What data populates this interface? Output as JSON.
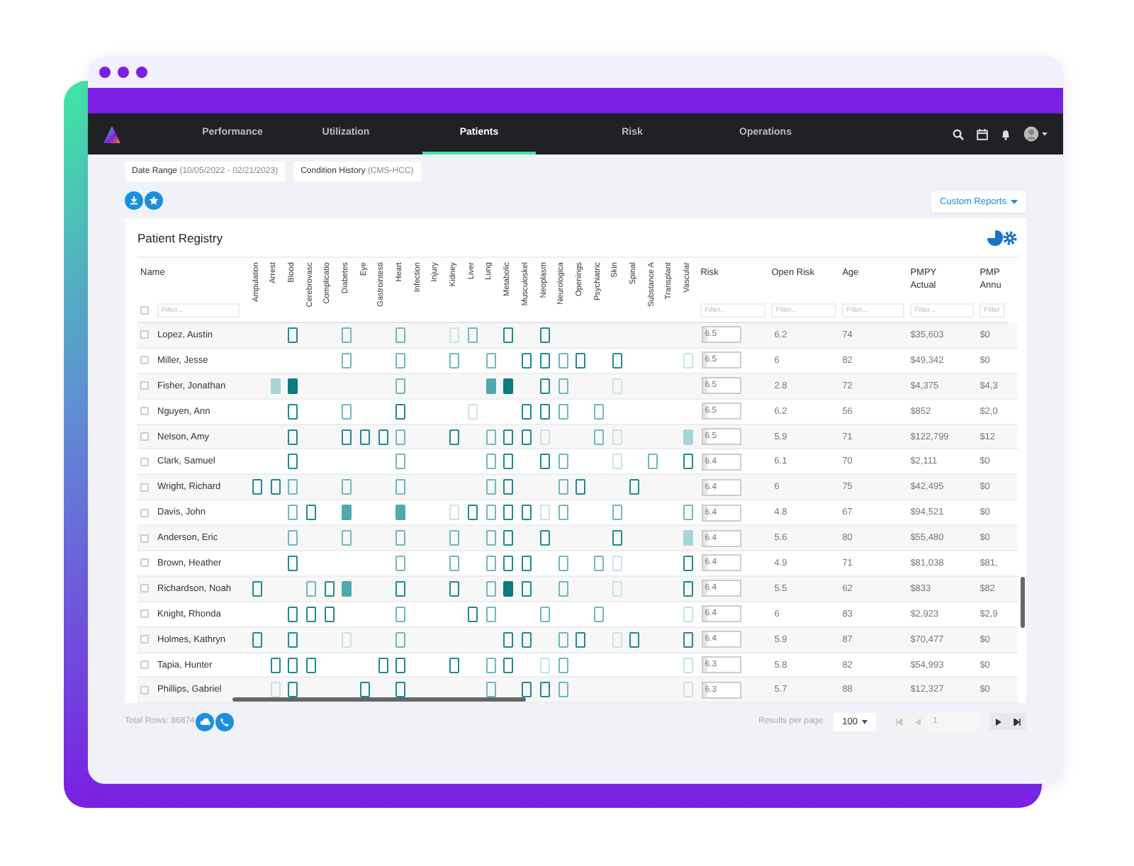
{
  "nav": {
    "tabs": [
      {
        "label": "Performance",
        "selected": false
      },
      {
        "label": "Utilization",
        "selected": false
      },
      {
        "label": "Patients",
        "selected": true
      },
      {
        "label": "Risk",
        "selected": false
      },
      {
        "label": "Operations",
        "selected": false
      }
    ]
  },
  "filters": [
    {
      "label": "Date Range",
      "value": "(10/05/2022 - 02/21/2023)"
    },
    {
      "label": "Condition History",
      "value": "(CMS-HCC)"
    }
  ],
  "custom_reports": {
    "label": "Custom Reports"
  },
  "registry": {
    "title": "Patient Registry",
    "name_column": {
      "label": "Name",
      "placeholder": "Filter...",
      "checked": false
    },
    "condition_columns": [
      "Ampulation",
      "Arrest",
      "Blood",
      "Cerebrovasc",
      "Complicatio",
      "Diabetes",
      "Eye",
      "Gastrointesti",
      "Heart",
      "Infection",
      "Injury",
      "Kidney",
      "Liver",
      "Lung",
      "Metabolic",
      "Musculoskel",
      "Neoplasm",
      "Neurologica",
      "Openings",
      "Psychiatric",
      "Skin",
      "Spinal",
      "Substance A",
      "Transplant",
      "Vascular"
    ],
    "value_columns": [
      {
        "label": "Risk",
        "placeholder": "Filter..."
      },
      {
        "label": "Open Risk",
        "placeholder": "Filter..."
      },
      {
        "label": "Age",
        "placeholder": "Filter..."
      },
      {
        "label": "PMPY",
        "sublabel": "Actual",
        "placeholder": "Filter..."
      },
      {
        "label": "PMP",
        "sublabel": "Annu",
        "placeholder": "Filter"
      }
    ],
    "rows": [
      {
        "name": "Lopez, Austin",
        "checked": false,
        "risk": "6.5",
        "open_risk": "6.2",
        "age": "74",
        "pmpy_actual": "$35,603",
        "column_5": "$0",
        "conditions": [
          {
            "kind": "none"
          },
          {
            "kind": "none"
          },
          {
            "kind": "outline",
            "color": "#1e8a8f"
          },
          {
            "kind": "none"
          },
          {
            "kind": "none"
          },
          {
            "kind": "outline",
            "color": "#6fb8bb"
          },
          {
            "kind": "none"
          },
          {
            "kind": "none"
          },
          {
            "kind": "outline",
            "color": "#6fb8bb"
          },
          {
            "kind": "none"
          },
          {
            "kind": "none"
          },
          {
            "kind": "outline",
            "color": "#c9e3e4"
          },
          {
            "kind": "outline",
            "color": "#6fb8bb"
          },
          {
            "kind": "none"
          },
          {
            "kind": "outline",
            "color": "#1e8a8f"
          },
          {
            "kind": "none"
          },
          {
            "kind": "outline",
            "color": "#1e8a8f"
          },
          {
            "kind": "none"
          },
          {
            "kind": "none"
          },
          {
            "kind": "none"
          },
          {
            "kind": "none"
          },
          {
            "kind": "none"
          },
          {
            "kind": "none"
          },
          {
            "kind": "none"
          },
          {
            "kind": "none"
          }
        ]
      },
      {
        "name": "Miller, Jesse",
        "checked": false,
        "risk": "6.5",
        "open_risk": "6",
        "age": "82",
        "pmpy_actual": "$49,342",
        "column_5": "$0",
        "conditions": [
          {
            "kind": "none"
          },
          {
            "kind": "none"
          },
          {
            "kind": "none"
          },
          {
            "kind": "none"
          },
          {
            "kind": "none"
          },
          {
            "kind": "outline",
            "color": "#6fb8bb"
          },
          {
            "kind": "none"
          },
          {
            "kind": "none"
          },
          {
            "kind": "outline",
            "color": "#6fb8bb"
          },
          {
            "kind": "none"
          },
          {
            "kind": "none"
          },
          {
            "kind": "outline",
            "color": "#6fb8bb"
          },
          {
            "kind": "none"
          },
          {
            "kind": "outline",
            "color": "#6fb8bb"
          },
          {
            "kind": "none"
          },
          {
            "kind": "outline",
            "color": "#1e8a8f"
          },
          {
            "kind": "outline",
            "color": "#1e8a8f"
          },
          {
            "kind": "outline",
            "color": "#6fb8bb"
          },
          {
            "kind": "outline",
            "color": "#1e8a8f"
          },
          {
            "kind": "none"
          },
          {
            "kind": "outline",
            "color": "#1e8a8f"
          },
          {
            "kind": "none"
          },
          {
            "kind": "none"
          },
          {
            "kind": "none"
          },
          {
            "kind": "outline",
            "color": "#c9e3e4"
          }
        ]
      },
      {
        "name": "Fisher, Jonathan",
        "checked": false,
        "risk": "6.5",
        "open_risk": "2.8",
        "age": "72",
        "pmpy_actual": "$4,375",
        "column_5": "$4,3",
        "conditions": [
          {
            "kind": "none"
          },
          {
            "kind": "filled",
            "color": "#a8d5d7"
          },
          {
            "kind": "filled",
            "color": "#0d7a80"
          },
          {
            "kind": "none"
          },
          {
            "kind": "none"
          },
          {
            "kind": "none"
          },
          {
            "kind": "none"
          },
          {
            "kind": "none"
          },
          {
            "kind": "outline",
            "color": "#6fb8bb"
          },
          {
            "kind": "none"
          },
          {
            "kind": "none"
          },
          {
            "kind": "none"
          },
          {
            "kind": "none"
          },
          {
            "kind": "filled",
            "color": "#4fa9ad"
          },
          {
            "kind": "filled",
            "color": "#0d7a80"
          },
          {
            "kind": "none"
          },
          {
            "kind": "outline",
            "color": "#1e8a8f"
          },
          {
            "kind": "outline",
            "color": "#6fb8bb"
          },
          {
            "kind": "none"
          },
          {
            "kind": "none"
          },
          {
            "kind": "outline",
            "color": "#c9e3e4"
          },
          {
            "kind": "none"
          },
          {
            "kind": "none"
          },
          {
            "kind": "none"
          },
          {
            "kind": "none"
          }
        ]
      },
      {
        "name": "Nguyen, Ann",
        "checked": false,
        "risk": "6.5",
        "open_risk": "6.2",
        "age": "56",
        "pmpy_actual": "$852",
        "column_5": "$2,0",
        "conditions": [
          {
            "kind": "none"
          },
          {
            "kind": "none"
          },
          {
            "kind": "outline",
            "color": "#1e8a8f"
          },
          {
            "kind": "none"
          },
          {
            "kind": "none"
          },
          {
            "kind": "outline",
            "color": "#6fb8bb"
          },
          {
            "kind": "none"
          },
          {
            "kind": "none"
          },
          {
            "kind": "outline",
            "color": "#1e8a8f"
          },
          {
            "kind": "none"
          },
          {
            "kind": "none"
          },
          {
            "kind": "none"
          },
          {
            "kind": "outline",
            "color": "#c9e3e4"
          },
          {
            "kind": "none"
          },
          {
            "kind": "none"
          },
          {
            "kind": "outline",
            "color": "#1e8a8f"
          },
          {
            "kind": "outline",
            "color": "#1e8a8f"
          },
          {
            "kind": "outline",
            "color": "#6fb8bb"
          },
          {
            "kind": "none"
          },
          {
            "kind": "outline",
            "color": "#6fb8bb"
          },
          {
            "kind": "none"
          },
          {
            "kind": "none"
          },
          {
            "kind": "none"
          },
          {
            "kind": "none"
          },
          {
            "kind": "none"
          }
        ]
      },
      {
        "name": "Nelson, Amy",
        "checked": false,
        "risk": "6.5",
        "open_risk": "5.9",
        "age": "71",
        "pmpy_actual": "$122,799",
        "column_5": "$12",
        "conditions": [
          {
            "kind": "none"
          },
          {
            "kind": "none"
          },
          {
            "kind": "outline",
            "color": "#1e8a8f"
          },
          {
            "kind": "none"
          },
          {
            "kind": "none"
          },
          {
            "kind": "outline",
            "color": "#1e8a8f"
          },
          {
            "kind": "outline",
            "color": "#1e8a8f"
          },
          {
            "kind": "outline",
            "color": "#1e8a8f"
          },
          {
            "kind": "outline",
            "color": "#6fb8bb"
          },
          {
            "kind": "none"
          },
          {
            "kind": "none"
          },
          {
            "kind": "outline",
            "color": "#1e8a8f"
          },
          {
            "kind": "none"
          },
          {
            "kind": "outline",
            "color": "#6fb8bb"
          },
          {
            "kind": "outline",
            "color": "#1e8a8f"
          },
          {
            "kind": "outline",
            "color": "#1e8a8f"
          },
          {
            "kind": "outline",
            "color": "#c9e3e4"
          },
          {
            "kind": "none"
          },
          {
            "kind": "none"
          },
          {
            "kind": "outline",
            "color": "#6fb8bb"
          },
          {
            "kind": "outline",
            "color": "#c9e3e4"
          },
          {
            "kind": "none"
          },
          {
            "kind": "none"
          },
          {
            "kind": "none"
          },
          {
            "kind": "filled",
            "color": "#a8d5d7"
          }
        ]
      },
      {
        "name": "Clark, Samuel",
        "checked": false,
        "risk": "6.4",
        "open_risk": "6.1",
        "age": "70",
        "pmpy_actual": "$2,111",
        "column_5": "$0",
        "conditions": [
          {
            "kind": "none"
          },
          {
            "kind": "none"
          },
          {
            "kind": "outline",
            "color": "#1e8a8f"
          },
          {
            "kind": "none"
          },
          {
            "kind": "none"
          },
          {
            "kind": "none"
          },
          {
            "kind": "none"
          },
          {
            "kind": "none"
          },
          {
            "kind": "outline",
            "color": "#6fb8bb"
          },
          {
            "kind": "none"
          },
          {
            "kind": "none"
          },
          {
            "kind": "none"
          },
          {
            "kind": "none"
          },
          {
            "kind": "outline",
            "color": "#6fb8bb"
          },
          {
            "kind": "outline",
            "color": "#1e8a8f"
          },
          {
            "kind": "none"
          },
          {
            "kind": "outline",
            "color": "#1e8a8f"
          },
          {
            "kind": "outline",
            "color": "#6fb8bb"
          },
          {
            "kind": "none"
          },
          {
            "kind": "none"
          },
          {
            "kind": "outline",
            "color": "#c9e3e4"
          },
          {
            "kind": "none"
          },
          {
            "kind": "outline",
            "color": "#6fb8bb"
          },
          {
            "kind": "none"
          },
          {
            "kind": "outline",
            "color": "#1e8a8f"
          }
        ]
      },
      {
        "name": "Wright, Richard",
        "checked": false,
        "risk": "6.4",
        "open_risk": "6",
        "age": "75",
        "pmpy_actual": "$42,495",
        "column_5": "$0",
        "conditions": [
          {
            "kind": "outline",
            "color": "#1e8a8f"
          },
          {
            "kind": "outline",
            "color": "#1e8a8f"
          },
          {
            "kind": "outline",
            "color": "#6fb8bb"
          },
          {
            "kind": "none"
          },
          {
            "kind": "none"
          },
          {
            "kind": "outline",
            "color": "#6fb8bb"
          },
          {
            "kind": "none"
          },
          {
            "kind": "none"
          },
          {
            "kind": "outline",
            "color": "#6fb8bb"
          },
          {
            "kind": "none"
          },
          {
            "kind": "none"
          },
          {
            "kind": "none"
          },
          {
            "kind": "none"
          },
          {
            "kind": "outline",
            "color": "#6fb8bb"
          },
          {
            "kind": "outline",
            "color": "#1e8a8f"
          },
          {
            "kind": "none"
          },
          {
            "kind": "none"
          },
          {
            "kind": "outline",
            "color": "#6fb8bb"
          },
          {
            "kind": "outline",
            "color": "#1e8a8f"
          },
          {
            "kind": "none"
          },
          {
            "kind": "none"
          },
          {
            "kind": "outline",
            "color": "#1e8a8f"
          },
          {
            "kind": "none"
          },
          {
            "kind": "none"
          },
          {
            "kind": "none"
          }
        ]
      },
      {
        "name": "Davis, John",
        "checked": false,
        "risk": "6.4",
        "open_risk": "4.8",
        "age": "67",
        "pmpy_actual": "$94,521",
        "column_5": "$0",
        "conditions": [
          {
            "kind": "none"
          },
          {
            "kind": "none"
          },
          {
            "kind": "outline",
            "color": "#6fb8bb"
          },
          {
            "kind": "outline",
            "color": "#1e8a8f"
          },
          {
            "kind": "none"
          },
          {
            "kind": "filled",
            "color": "#4fa9ad"
          },
          {
            "kind": "none"
          },
          {
            "kind": "none"
          },
          {
            "kind": "filled",
            "color": "#4fa9ad"
          },
          {
            "kind": "none"
          },
          {
            "kind": "none"
          },
          {
            "kind": "outline",
            "color": "#c9e3e4"
          },
          {
            "kind": "outline",
            "color": "#1e8a8f"
          },
          {
            "kind": "outline",
            "color": "#6fb8bb"
          },
          {
            "kind": "outline",
            "color": "#1e8a8f"
          },
          {
            "kind": "outline",
            "color": "#1e8a8f"
          },
          {
            "kind": "outline",
            "color": "#c9e3e4"
          },
          {
            "kind": "outline",
            "color": "#6fb8bb"
          },
          {
            "kind": "none"
          },
          {
            "kind": "none"
          },
          {
            "kind": "outline",
            "color": "#6fb8bb"
          },
          {
            "kind": "none"
          },
          {
            "kind": "none"
          },
          {
            "kind": "none"
          },
          {
            "kind": "outline",
            "color": "#6fb8bb"
          }
        ]
      },
      {
        "name": "Anderson, Eric",
        "checked": false,
        "risk": "6.4",
        "open_risk": "5.6",
        "age": "80",
        "pmpy_actual": "$55,480",
        "column_5": "$0",
        "conditions": [
          {
            "kind": "none"
          },
          {
            "kind": "none"
          },
          {
            "kind": "outline",
            "color": "#6fb8bb"
          },
          {
            "kind": "none"
          },
          {
            "kind": "none"
          },
          {
            "kind": "outline",
            "color": "#6fb8bb"
          },
          {
            "kind": "none"
          },
          {
            "kind": "none"
          },
          {
            "kind": "outline",
            "color": "#6fb8bb"
          },
          {
            "kind": "none"
          },
          {
            "kind": "none"
          },
          {
            "kind": "outline",
            "color": "#6fb8bb"
          },
          {
            "kind": "none"
          },
          {
            "kind": "outline",
            "color": "#6fb8bb"
          },
          {
            "kind": "outline",
            "color": "#1e8a8f"
          },
          {
            "kind": "none"
          },
          {
            "kind": "outline",
            "color": "#1e8a8f"
          },
          {
            "kind": "none"
          },
          {
            "kind": "none"
          },
          {
            "kind": "none"
          },
          {
            "kind": "outline",
            "color": "#1e8a8f"
          },
          {
            "kind": "none"
          },
          {
            "kind": "none"
          },
          {
            "kind": "none"
          },
          {
            "kind": "filled",
            "color": "#a8d5d7"
          }
        ]
      },
      {
        "name": "Brown, Heather",
        "checked": false,
        "risk": "6.4",
        "open_risk": "4.9",
        "age": "71",
        "pmpy_actual": "$81,038",
        "column_5": "$81,",
        "conditions": [
          {
            "kind": "none"
          },
          {
            "kind": "none"
          },
          {
            "kind": "outline",
            "color": "#1e8a8f"
          },
          {
            "kind": "none"
          },
          {
            "kind": "none"
          },
          {
            "kind": "none"
          },
          {
            "kind": "none"
          },
          {
            "kind": "none"
          },
          {
            "kind": "outline",
            "color": "#6fb8bb"
          },
          {
            "kind": "none"
          },
          {
            "kind": "none"
          },
          {
            "kind": "outline",
            "color": "#6fb8bb"
          },
          {
            "kind": "none"
          },
          {
            "kind": "outline",
            "color": "#6fb8bb"
          },
          {
            "kind": "outline",
            "color": "#1e8a8f"
          },
          {
            "kind": "outline",
            "color": "#1e8a8f"
          },
          {
            "kind": "none"
          },
          {
            "kind": "outline",
            "color": "#6fb8bb"
          },
          {
            "kind": "none"
          },
          {
            "kind": "outline",
            "color": "#6fb8bb"
          },
          {
            "kind": "outline",
            "color": "#c9e3e4"
          },
          {
            "kind": "none"
          },
          {
            "kind": "none"
          },
          {
            "kind": "none"
          },
          {
            "kind": "outline",
            "color": "#1e8a8f"
          }
        ]
      },
      {
        "name": "Richardson, Noah",
        "checked": false,
        "risk": "6.4",
        "open_risk": "5.5",
        "age": "62",
        "pmpy_actual": "$833",
        "column_5": "$82",
        "conditions": [
          {
            "kind": "outline",
            "color": "#1e8a8f"
          },
          {
            "kind": "none"
          },
          {
            "kind": "none"
          },
          {
            "kind": "outline",
            "color": "#6fb8bb"
          },
          {
            "kind": "outline",
            "color": "#1e8a8f"
          },
          {
            "kind": "filled",
            "color": "#4fa9ad"
          },
          {
            "kind": "none"
          },
          {
            "kind": "none"
          },
          {
            "kind": "outline",
            "color": "#1e8a8f"
          },
          {
            "kind": "none"
          },
          {
            "kind": "none"
          },
          {
            "kind": "outline",
            "color": "#1e8a8f"
          },
          {
            "kind": "none"
          },
          {
            "kind": "outline",
            "color": "#6fb8bb"
          },
          {
            "kind": "filled",
            "color": "#0d7a80"
          },
          {
            "kind": "outline",
            "color": "#1e8a8f"
          },
          {
            "kind": "none"
          },
          {
            "kind": "outline",
            "color": "#6fb8bb"
          },
          {
            "kind": "none"
          },
          {
            "kind": "none"
          },
          {
            "kind": "outline",
            "color": "#c9e3e4"
          },
          {
            "kind": "none"
          },
          {
            "kind": "none"
          },
          {
            "kind": "none"
          },
          {
            "kind": "outline",
            "color": "#1e8a8f"
          }
        ]
      },
      {
        "name": "Knight, Rhonda",
        "checked": false,
        "risk": "6.4",
        "open_risk": "6",
        "age": "83",
        "pmpy_actual": "$2,923",
        "column_5": "$2,9",
        "conditions": [
          {
            "kind": "none"
          },
          {
            "kind": "none"
          },
          {
            "kind": "outline",
            "color": "#1e8a8f"
          },
          {
            "kind": "outline",
            "color": "#1e8a8f"
          },
          {
            "kind": "outline",
            "color": "#1e8a8f"
          },
          {
            "kind": "none"
          },
          {
            "kind": "none"
          },
          {
            "kind": "none"
          },
          {
            "kind": "outline",
            "color": "#6fb8bb"
          },
          {
            "kind": "none"
          },
          {
            "kind": "none"
          },
          {
            "kind": "none"
          },
          {
            "kind": "outline",
            "color": "#1e8a8f"
          },
          {
            "kind": "outline",
            "color": "#6fb8bb"
          },
          {
            "kind": "none"
          },
          {
            "kind": "none"
          },
          {
            "kind": "outline",
            "color": "#6fb8bb"
          },
          {
            "kind": "none"
          },
          {
            "kind": "none"
          },
          {
            "kind": "outline",
            "color": "#6fb8bb"
          },
          {
            "kind": "none"
          },
          {
            "kind": "none"
          },
          {
            "kind": "none"
          },
          {
            "kind": "none"
          },
          {
            "kind": "outline",
            "color": "#c9e3e4"
          }
        ]
      },
      {
        "name": "Holmes, Kathryn",
        "checked": false,
        "risk": "6.4",
        "open_risk": "5.9",
        "age": "87",
        "pmpy_actual": "$70,477",
        "column_5": "$0",
        "conditions": [
          {
            "kind": "outline",
            "color": "#1e8a8f"
          },
          {
            "kind": "none"
          },
          {
            "kind": "outline",
            "color": "#1e8a8f"
          },
          {
            "kind": "none"
          },
          {
            "kind": "none"
          },
          {
            "kind": "outline",
            "color": "#c9e3e4"
          },
          {
            "kind": "none"
          },
          {
            "kind": "none"
          },
          {
            "kind": "outline",
            "color": "#6fb8bb"
          },
          {
            "kind": "none"
          },
          {
            "kind": "none"
          },
          {
            "kind": "none"
          },
          {
            "kind": "none"
          },
          {
            "kind": "none"
          },
          {
            "kind": "outline",
            "color": "#1e8a8f"
          },
          {
            "kind": "outline",
            "color": "#1e8a8f"
          },
          {
            "kind": "none"
          },
          {
            "kind": "outline",
            "color": "#6fb8bb"
          },
          {
            "kind": "outline",
            "color": "#1e8a8f"
          },
          {
            "kind": "none"
          },
          {
            "kind": "outline",
            "color": "#c9e3e4"
          },
          {
            "kind": "outline",
            "color": "#1e8a8f"
          },
          {
            "kind": "none"
          },
          {
            "kind": "none"
          },
          {
            "kind": "outline",
            "color": "#1e8a8f"
          }
        ]
      },
      {
        "name": "Tapia, Hunter",
        "checked": false,
        "risk": "6.3",
        "open_risk": "5.8",
        "age": "82",
        "pmpy_actual": "$54,993",
        "column_5": "$0",
        "conditions": [
          {
            "kind": "none"
          },
          {
            "kind": "outline",
            "color": "#1e8a8f"
          },
          {
            "kind": "outline",
            "color": "#1e8a8f"
          },
          {
            "kind": "outline",
            "color": "#1e8a8f"
          },
          {
            "kind": "none"
          },
          {
            "kind": "none"
          },
          {
            "kind": "none"
          },
          {
            "kind": "outline",
            "color": "#1e8a8f"
          },
          {
            "kind": "outline",
            "color": "#1e8a8f"
          },
          {
            "kind": "none"
          },
          {
            "kind": "none"
          },
          {
            "kind": "outline",
            "color": "#1e8a8f"
          },
          {
            "kind": "none"
          },
          {
            "kind": "outline",
            "color": "#6fb8bb"
          },
          {
            "kind": "outline",
            "color": "#1e8a8f"
          },
          {
            "kind": "none"
          },
          {
            "kind": "outline",
            "color": "#c9e3e4"
          },
          {
            "kind": "outline",
            "color": "#6fb8bb"
          },
          {
            "kind": "none"
          },
          {
            "kind": "none"
          },
          {
            "kind": "none"
          },
          {
            "kind": "none"
          },
          {
            "kind": "none"
          },
          {
            "kind": "none"
          },
          {
            "kind": "outline",
            "color": "#c9e3e4"
          }
        ]
      },
      {
        "name": "Phillips, Gabriel",
        "checked": false,
        "risk": "6.3",
        "open_risk": "5.7",
        "age": "88",
        "pmpy_actual": "$12,327",
        "column_5": "$0",
        "conditions": [
          {
            "kind": "none"
          },
          {
            "kind": "outline",
            "color": "#c9e3e4"
          },
          {
            "kind": "outline",
            "color": "#1e8a8f"
          },
          {
            "kind": "none"
          },
          {
            "kind": "none"
          },
          {
            "kind": "none"
          },
          {
            "kind": "outline",
            "color": "#1e8a8f"
          },
          {
            "kind": "none"
          },
          {
            "kind": "outline",
            "color": "#1e8a8f"
          },
          {
            "kind": "none"
          },
          {
            "kind": "none"
          },
          {
            "kind": "none"
          },
          {
            "kind": "none"
          },
          {
            "kind": "outline",
            "color": "#6fb8bb"
          },
          {
            "kind": "none"
          },
          {
            "kind": "outline",
            "color": "#1e8a8f"
          },
          {
            "kind": "outline",
            "color": "#1e8a8f"
          },
          {
            "kind": "outline",
            "color": "#6fb8bb"
          },
          {
            "kind": "none"
          },
          {
            "kind": "none"
          },
          {
            "kind": "none"
          },
          {
            "kind": "none"
          },
          {
            "kind": "none"
          },
          {
            "kind": "none"
          },
          {
            "kind": "outline",
            "color": "#c9e3e4"
          }
        ]
      }
    ]
  },
  "footer": {
    "total_rows": "Total Rows: 86874",
    "results_label": "Results per page:",
    "per_page": "100",
    "page": "1",
    "first_disabled": true,
    "prev_disabled": true
  }
}
